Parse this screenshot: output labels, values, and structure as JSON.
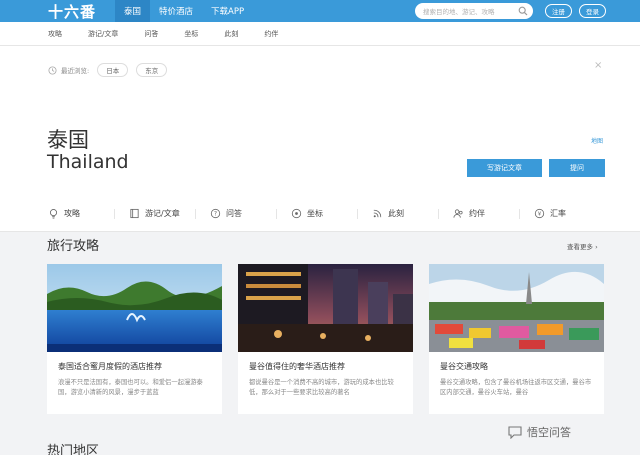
{
  "header": {
    "logo": "十六番",
    "nav": [
      "泰国",
      "特价酒店",
      "下载APP"
    ],
    "search_placeholder": "搜索目的地、游记、攻略",
    "register": "注册",
    "login": "登录"
  },
  "subnav": [
    "攻略",
    "游记/文章",
    "问答",
    "坐标",
    "此刻",
    "约伴"
  ],
  "recent": {
    "label": "最近浏览:",
    "items": [
      "日本",
      "东京"
    ],
    "close": "×"
  },
  "destination": {
    "name_cn": "泰国",
    "name_en": "Thailand",
    "map_link": "地图",
    "write_button": "写游记文章",
    "ask_button": "提问"
  },
  "tabs": [
    {
      "label": "攻略",
      "icon": "bulb-icon"
    },
    {
      "label": "游记/文章",
      "icon": "book-icon"
    },
    {
      "label": "问答",
      "icon": "question-icon"
    },
    {
      "label": "坐标",
      "icon": "location-icon"
    },
    {
      "label": "此刻",
      "icon": "signal-icon"
    },
    {
      "label": "约伴",
      "icon": "people-icon"
    },
    {
      "label": "汇率",
      "icon": "exchange-icon"
    }
  ],
  "guides": {
    "title": "旅行攻略",
    "more": "查看更多 ›",
    "cards": [
      {
        "title": "泰国适合蜜月度假的酒店推荐",
        "desc": "浪漫不只是法国有，泰国也可以。和爱侣一起漫游泰国，游览小清新的风景，漫步于蓝蓝"
      },
      {
        "title": "曼谷值得住的奢华酒店推荐",
        "desc": "都说曼谷是一个消费不高的城市，游玩的成本也比较低，那么对于一些要求比较高的著名"
      },
      {
        "title": "曼谷交通攻略",
        "desc": "曼谷交通攻略，包含了曼谷机场往返市区交通，曼谷市区内部交通，曼谷火车站，曼谷"
      }
    ]
  },
  "hot_areas_title": "热门地区",
  "watermark": "悟空问答",
  "colors": {
    "brand": "#3a9ad9",
    "brand_dark": "#2d86c6"
  }
}
